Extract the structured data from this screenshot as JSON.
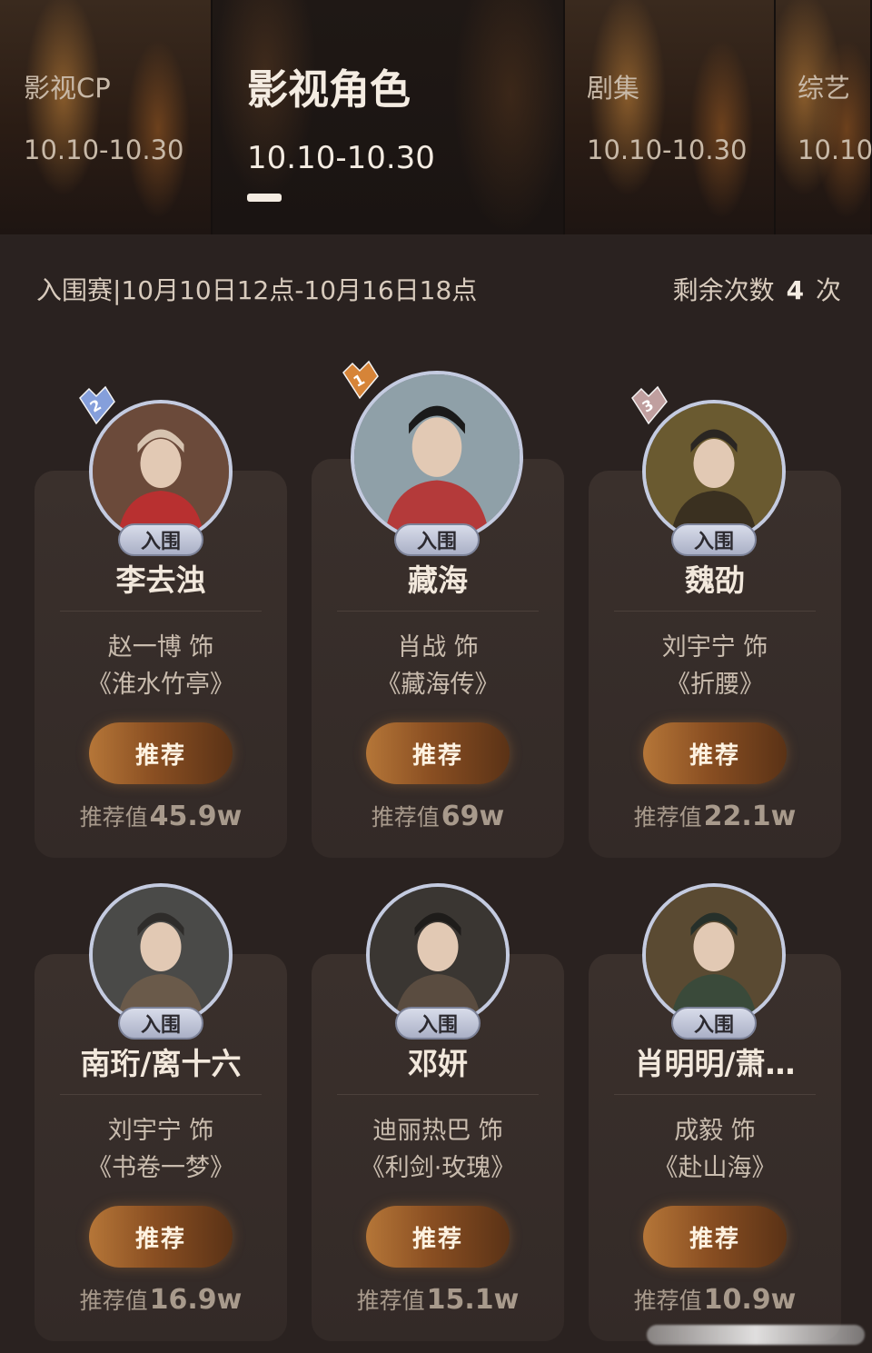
{
  "tabs": [
    {
      "name": "影视CP",
      "date": "10.10-10.30",
      "active": false
    },
    {
      "name": "影视角色",
      "date": "10.10-10.30",
      "active": true
    },
    {
      "name": "剧集",
      "date": "10.10-10.30",
      "active": false
    },
    {
      "name": "综艺",
      "date": "10.10-",
      "active": false
    }
  ],
  "info": {
    "round": "入围赛|10月10日12点-10月16日18点",
    "remaining_label": "剩余次数",
    "remaining_count": "4",
    "remaining_unit": "次"
  },
  "colors": {
    "background": "#2a2220",
    "card": "#3a302c",
    "button": "#a56a33",
    "rank_1": "#e08a3a",
    "rank_2": "#8aa6e6",
    "rank_3": "#c9a6a6"
  },
  "cards": [
    {
      "rank": "2",
      "status": "入围",
      "name": "李去浊",
      "actor": "赵一博 饰",
      "drama": "《淮水竹亭》",
      "button": "推荐",
      "score_label": "推荐值",
      "score": "45.9w"
    },
    {
      "rank": "1",
      "status": "入围",
      "name": "藏海",
      "actor": "肖战 饰",
      "drama": "《藏海传》",
      "button": "推荐",
      "score_label": "推荐值",
      "score": "69w"
    },
    {
      "rank": "3",
      "status": "入围",
      "name": "魏劭",
      "actor": "刘宇宁 饰",
      "drama": "《折腰》",
      "button": "推荐",
      "score_label": "推荐值",
      "score": "22.1w"
    },
    {
      "rank": "",
      "status": "入围",
      "name": "南珩/离十六",
      "actor": "刘宇宁 饰",
      "drama": "《书卷一梦》",
      "button": "推荐",
      "score_label": "推荐值",
      "score": "16.9w"
    },
    {
      "rank": "",
      "status": "入围",
      "name": "邓妍",
      "actor": "迪丽热巴 饰",
      "drama": "《利剑·玫瑰》",
      "button": "推荐",
      "score_label": "推荐值",
      "score": "15.1w"
    },
    {
      "rank": "",
      "status": "入围",
      "name": "肖明明/萧…",
      "actor": "成毅 饰",
      "drama": "《赴山海》",
      "button": "推荐",
      "score_label": "推荐值",
      "score": "10.9w"
    }
  ]
}
